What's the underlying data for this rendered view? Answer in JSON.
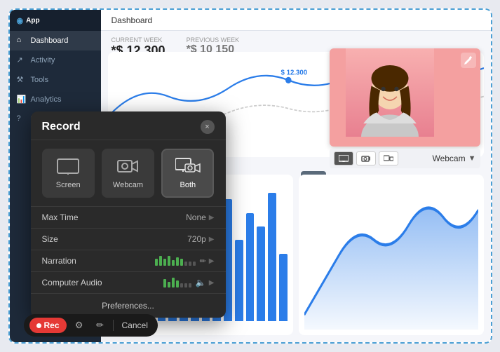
{
  "app": {
    "title": "Dashboard"
  },
  "sidebar": {
    "items": [
      {
        "id": "dashboard",
        "label": "Dashboard",
        "active": true
      },
      {
        "id": "activity",
        "label": "Activity",
        "active": false
      },
      {
        "id": "tools",
        "label": "Tools",
        "active": false
      },
      {
        "id": "analytics",
        "label": "Analytics",
        "active": false
      },
      {
        "id": "help",
        "label": "Help",
        "active": false
      }
    ]
  },
  "stats": {
    "current_week_label": "Current week",
    "current_value": "*$ 12 300",
    "previous_week_label": "Previous week",
    "previous_value": "*$ 10 150"
  },
  "webcam": {
    "label": "Webcam",
    "dropdown_icon": "▼"
  },
  "record_modal": {
    "title": "Record",
    "close_label": "×",
    "source_types": [
      {
        "id": "screen",
        "label": "Screen",
        "icon": "🖥"
      },
      {
        "id": "webcam",
        "label": "Webcam",
        "icon": "📷"
      },
      {
        "id": "both",
        "label": "Both",
        "icon": "⊞",
        "active": true
      }
    ],
    "settings": [
      {
        "id": "max_time",
        "label": "Max Time",
        "value": "None"
      },
      {
        "id": "size",
        "label": "Size",
        "value": "720p"
      },
      {
        "id": "narration",
        "label": "Narration",
        "value": "",
        "has_volume": true,
        "has_pencil": true
      },
      {
        "id": "computer_audio",
        "label": "Computer Audio",
        "value": "",
        "has_volume": true,
        "has_speaker": true
      }
    ],
    "preferences_label": "Preferences..."
  },
  "toolbar": {
    "rec_label": "Rec",
    "cancel_label": "Cancel"
  },
  "bar_chart": {
    "bars": [
      0.6,
      0.8,
      0.5,
      0.9,
      0.7,
      1.0,
      0.65,
      0.85,
      0.55,
      0.75,
      0.9,
      0.6,
      0.8,
      0.7,
      0.95,
      0.5
    ]
  },
  "move_icon": "✥",
  "colors": {
    "accent": "#2b7de9",
    "record_red": "#e53935",
    "sidebar_bg": "#1e2a3a",
    "modal_bg": "#2a2a2a",
    "active_green": "#4caf50"
  }
}
